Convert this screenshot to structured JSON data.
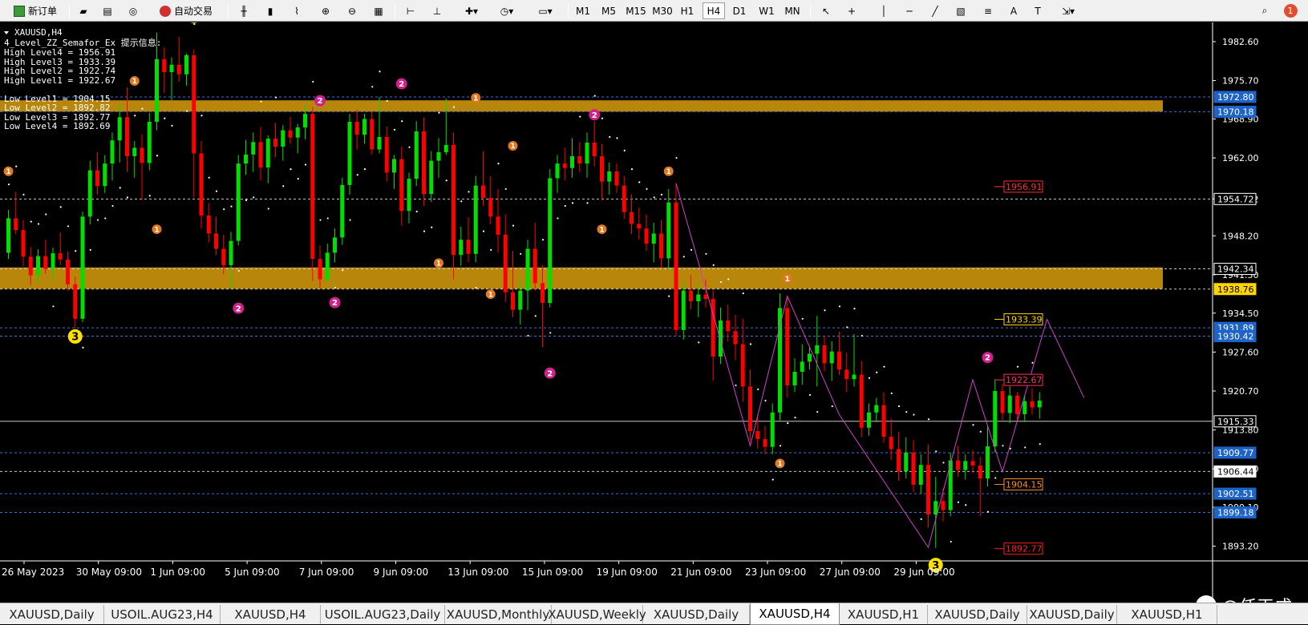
{
  "toolbar": {
    "new_order": "新订单",
    "auto_trade": "自动交易",
    "timeframes": [
      "M1",
      "M5",
      "M15",
      "M30",
      "H1",
      "H4",
      "D1",
      "W1",
      "MN"
    ],
    "active_timeframe": "H4",
    "notification_count": "1"
  },
  "chart_info": {
    "symbol": "XAUUSD,H4",
    "indicator_title": "4_Level_ZZ_Semafor_Ex 提示信息:",
    "lines": [
      "High Level4 = 1956.91",
      "High Level3 = 1933.39",
      "High Level2 = 1922.74",
      "High Level1 = 1922.67",
      "",
      "Low Level1 = 1904.15",
      "Low Level2 = 1892.82",
      "Low Level3 = 1892.77",
      "Low Level4 = 1892.69"
    ]
  },
  "price_axis": {
    "ticks": [
      "1982.60",
      "1975.70",
      "1968.90",
      "1962.00",
      "1954.72",
      "1948.20",
      "1941.30",
      "1934.50",
      "1927.60",
      "1920.70",
      "1913.80",
      "1906.90",
      "1900.10",
      "1893.20"
    ],
    "highlights": [
      {
        "label": "1972.80",
        "price": 1972.8,
        "bg": "#1e64c8",
        "fg": "#ffffff"
      },
      {
        "label": "1970.18",
        "price": 1970.18,
        "bg": "#1e64c8",
        "fg": "#ffffff"
      },
      {
        "label": "1954.72",
        "price": 1954.72,
        "bg": "#000000",
        "fg": "#ffffff"
      },
      {
        "label": "1942.34",
        "price": 1942.34,
        "bg": "#000000",
        "fg": "#ffffff"
      },
      {
        "label": "1938.76",
        "price": 1938.76,
        "bg": "#ffd400",
        "fg": "#000000"
      },
      {
        "label": "1931.89",
        "price": 1931.89,
        "bg": "#1e64c8",
        "fg": "#ffffff"
      },
      {
        "label": "1930.42",
        "price": 1930.42,
        "bg": "#1e64c8",
        "fg": "#ffffff"
      },
      {
        "label": "1915.33",
        "price": 1915.33,
        "bg": "#000000",
        "fg": "#ffffff"
      },
      {
        "label": "1909.77",
        "price": 1909.77,
        "bg": "#1e64c8",
        "fg": "#ffffff"
      },
      {
        "label": "1906.44",
        "price": 1906.44,
        "bg": "#ffffff",
        "fg": "#000000"
      },
      {
        "label": "1902.51",
        "price": 1902.51,
        "bg": "#1e64c8",
        "fg": "#ffffff"
      },
      {
        "label": "1899.18",
        "price": 1899.18,
        "bg": "#1e64c8",
        "fg": "#ffffff"
      }
    ]
  },
  "level_labels": [
    {
      "label": "1956.91",
      "price": 1956.91,
      "color": "#ff3030"
    },
    {
      "label": "1933.39",
      "price": 1933.39,
      "color": "#ffd400"
    },
    {
      "label": "1922.67",
      "price": 1922.67,
      "color": "#ff3060"
    },
    {
      "label": "1904.15",
      "price": 1904.15,
      "color": "#ff8c20"
    },
    {
      "label": "1892.77",
      "price": 1892.77,
      "color": "#ff2020"
    }
  ],
  "time_axis": [
    "26 May 2023",
    "30 May 09:00",
    "1 Jun 09:00",
    "5 Jun 09:00",
    "7 Jun 09:00",
    "9 Jun 09:00",
    "13 Jun 09:00",
    "15 Jun 09:00",
    "19 Jun 09:00",
    "21 Jun 09:00",
    "23 Jun 09:00",
    "27 Jun 09:00",
    "29 Jun 09:00"
  ],
  "zones": [
    {
      "top": 1972.2,
      "bottom": 1970.2,
      "color": "#b8860b"
    },
    {
      "top": 1942.6,
      "bottom": 1938.8,
      "color": "#b8860b"
    }
  ],
  "tabs": [
    "XAUUSD,Daily",
    "USOIL.AUG23,H4",
    "XAUUSD,H4",
    "USOIL.AUG23,Daily",
    "XAUUSD,Monthly",
    "XAUUSD,Weekly",
    "XAUUSD,Daily",
    "XAUUSD,H4",
    "XAUUSD,H1",
    "XAUUSD,Daily",
    "XAUUSD,Daily",
    "XAUUSD,H1"
  ],
  "active_tab_index": 7,
  "watermark": "@任天成",
  "colors": {
    "bull": "#00e000",
    "bear": "#ff0000",
    "zigzag": "#d040d0",
    "zone": "#b8860b",
    "sar": "#ffffff"
  },
  "chart_data": {
    "type": "candlestick",
    "symbol": "XAUUSD",
    "timeframe": "H4",
    "ylim": [
      1890.6,
      1986.0
    ],
    "current_price": 1915.33,
    "zigzag_projection": [
      {
        "bar": 90,
        "price": 1957.5
      },
      {
        "bar": 100,
        "price": 1911.0
      },
      {
        "bar": 105,
        "price": 1937.5
      },
      {
        "bar": 112,
        "price": 1916.5
      },
      {
        "bar": 124,
        "price": 1893.0
      },
      {
        "bar": 130,
        "price": 1922.7
      },
      {
        "bar": 134,
        "price": 1906.4
      },
      {
        "bar": 140,
        "price": 1933.4
      },
      {
        "bar": 145,
        "price": 1919.5
      }
    ],
    "semafor_points": [
      {
        "bar": 9,
        "price": 1931.5,
        "level": 3,
        "pos": "below"
      },
      {
        "bar": 25,
        "price": 1986.0,
        "level": 3,
        "pos": "above"
      },
      {
        "bar": 31,
        "price": 1936.5,
        "level": 2,
        "pos": "below"
      },
      {
        "bar": 42,
        "price": 1971.0,
        "level": 2,
        "pos": "above"
      },
      {
        "bar": 44,
        "price": 1937.5,
        "level": 2,
        "pos": "below"
      },
      {
        "bar": 53,
        "price": 1974.0,
        "level": 2,
        "pos": "above"
      },
      {
        "bar": 73,
        "price": 1925.0,
        "level": 2,
        "pos": "below"
      },
      {
        "bar": 79,
        "price": 1968.5,
        "level": 2,
        "pos": "above"
      },
      {
        "bar": 132,
        "price": 1925.5,
        "level": 2,
        "pos": "above"
      },
      {
        "bar": 125,
        "price": 1891.0,
        "level": 3,
        "pos": "below"
      },
      {
        "bar": 17,
        "price": 1974.5,
        "level": 1,
        "pos": "above"
      },
      {
        "bar": 20,
        "price": 1950.5,
        "level": 1,
        "pos": "below"
      },
      {
        "bar": 58,
        "price": 1944.5,
        "level": 1,
        "pos": "below"
      },
      {
        "bar": 63,
        "price": 1971.5,
        "level": 1,
        "pos": "above"
      },
      {
        "bar": 65,
        "price": 1939.0,
        "level": 1,
        "pos": "below"
      },
      {
        "bar": 68,
        "price": 1963.0,
        "level": 1,
        "pos": "above"
      },
      {
        "bar": 80,
        "price": 1950.5,
        "level": 1,
        "pos": "below"
      },
      {
        "bar": 89,
        "price": 1958.5,
        "level": 1,
        "pos": "above"
      },
      {
        "bar": 105,
        "price": 1939.5,
        "level": 1,
        "pos": "above"
      },
      {
        "bar": 104,
        "price": 1909.0,
        "level": 1,
        "pos": "below"
      },
      {
        "bar": 0,
        "price": 1958.5,
        "level": 1,
        "pos": "above"
      }
    ],
    "candles": [
      [
        1945.2,
        1952.8,
        1944.1,
        1951.3
      ],
      [
        1951.3,
        1956.0,
        1948.5,
        1949.2
      ],
      [
        1949.2,
        1951.0,
        1942.8,
        1944.5
      ],
      [
        1944.5,
        1946.2,
        1939.5,
        1941.2
      ],
      [
        1941.2,
        1945.8,
        1939.8,
        1944.6
      ],
      [
        1944.6,
        1947.5,
        1941.5,
        1942.3
      ],
      [
        1942.3,
        1946.1,
        1940.2,
        1945.1
      ],
      [
        1945.1,
        1948.8,
        1943.0,
        1944.0
      ],
      [
        1944.0,
        1945.4,
        1938.5,
        1939.6
      ],
      [
        1939.6,
        1941.0,
        1931.8,
        1933.5
      ],
      [
        1933.5,
        1952.5,
        1932.9,
        1951.6
      ],
      [
        1951.6,
        1961.5,
        1950.2,
        1959.8
      ],
      [
        1959.8,
        1963.0,
        1955.5,
        1957.0
      ],
      [
        1957.0,
        1962.5,
        1955.8,
        1961.0
      ],
      [
        1961.0,
        1966.5,
        1958.0,
        1965.1
      ],
      [
        1965.1,
        1971.4,
        1961.2,
        1969.2
      ],
      [
        1969.2,
        1974.5,
        1959.5,
        1962.3
      ],
      [
        1962.3,
        1965.0,
        1958.5,
        1963.8
      ],
      [
        1963.8,
        1966.2,
        1954.5,
        1961.1
      ],
      [
        1961.1,
        1970.0,
        1959.8,
        1968.4
      ],
      [
        1968.4,
        1984.2,
        1966.9,
        1979.5
      ],
      [
        1979.5,
        1981.6,
        1973.5,
        1977.2
      ],
      [
        1977.2,
        1979.8,
        1972.2,
        1978.5
      ],
      [
        1978.5,
        1983.5,
        1975.5,
        1976.8
      ],
      [
        1976.8,
        1980.5,
        1974.8,
        1980.2
      ],
      [
        1980.2,
        1981.2,
        1955.0,
        1962.8
      ],
      [
        1962.8,
        1965.0,
        1949.5,
        1951.8
      ],
      [
        1951.8,
        1954.0,
        1947.0,
        1948.6
      ],
      [
        1948.6,
        1951.6,
        1944.8,
        1945.9
      ],
      [
        1945.9,
        1948.4,
        1941.4,
        1943.0
      ],
      [
        1943.0,
        1948.9,
        1938.8,
        1947.3
      ],
      [
        1947.3,
        1962.5,
        1946.5,
        1961.0
      ],
      [
        1961.0,
        1965.2,
        1959.0,
        1962.6
      ],
      [
        1962.6,
        1966.5,
        1959.5,
        1964.8
      ],
      [
        1964.8,
        1967.5,
        1958.0,
        1960.3
      ],
      [
        1960.3,
        1966.0,
        1957.5,
        1965.4
      ],
      [
        1965.4,
        1968.2,
        1962.1,
        1964.0
      ],
      [
        1964.0,
        1967.8,
        1961.5,
        1966.9
      ],
      [
        1966.9,
        1969.3,
        1964.5,
        1965.6
      ],
      [
        1965.6,
        1968.0,
        1962.8,
        1967.4
      ],
      [
        1967.4,
        1971.5,
        1965.3,
        1969.8
      ],
      [
        1969.8,
        1971.0,
        1940.2,
        1944.1
      ],
      [
        1944.1,
        1946.5,
        1939.0,
        1940.5
      ],
      [
        1940.5,
        1946.8,
        1939.8,
        1945.2
      ],
      [
        1945.2,
        1949.5,
        1943.5,
        1947.9
      ],
      [
        1947.9,
        1958.5,
        1946.6,
        1957.2
      ],
      [
        1957.2,
        1969.8,
        1955.5,
        1968.4
      ],
      [
        1968.4,
        1970.5,
        1963.5,
        1966.1
      ],
      [
        1966.1,
        1969.8,
        1964.5,
        1968.9
      ],
      [
        1968.9,
        1970.1,
        1962.6,
        1963.5
      ],
      [
        1963.5,
        1972.8,
        1962.8,
        1965.7
      ],
      [
        1965.7,
        1967.6,
        1957.8,
        1959.4
      ],
      [
        1959.4,
        1962.5,
        1956.5,
        1961.8
      ],
      [
        1961.8,
        1964.0,
        1950.0,
        1952.6
      ],
      [
        1952.6,
        1959.4,
        1950.4,
        1958.3
      ],
      [
        1958.3,
        1968.5,
        1957.0,
        1966.7
      ],
      [
        1966.7,
        1969.2,
        1953.5,
        1955.6
      ],
      [
        1955.6,
        1963.2,
        1954.2,
        1961.5
      ],
      [
        1961.5,
        1965.5,
        1958.5,
        1963.0
      ],
      [
        1963.0,
        1972.5,
        1962.5,
        1964.3
      ],
      [
        1964.3,
        1966.5,
        1940.5,
        1944.8
      ],
      [
        1944.8,
        1949.8,
        1942.9,
        1947.5
      ],
      [
        1947.5,
        1951.5,
        1943.5,
        1945.0
      ],
      [
        1945.0,
        1958.8,
        1943.5,
        1957.1
      ],
      [
        1957.1,
        1963.2,
        1953.5,
        1954.9
      ],
      [
        1954.9,
        1958.8,
        1950.2,
        1951.6
      ],
      [
        1951.6,
        1956.5,
        1945.2,
        1948.4
      ],
      [
        1948.4,
        1952.0,
        1936.5,
        1938.2
      ],
      [
        1938.2,
        1945.5,
        1933.8,
        1935.1
      ],
      [
        1935.1,
        1940.5,
        1932.5,
        1938.5
      ],
      [
        1938.5,
        1947.5,
        1935.0,
        1945.9
      ],
      [
        1945.9,
        1950.5,
        1938.5,
        1939.8
      ],
      [
        1939.8,
        1943.0,
        1928.5,
        1936.3
      ],
      [
        1936.3,
        1960.0,
        1935.5,
        1958.4
      ],
      [
        1958.4,
        1962.5,
        1955.8,
        1961.0
      ],
      [
        1961.0,
        1963.8,
        1958.0,
        1960.2
      ],
      [
        1960.2,
        1965.5,
        1958.5,
        1962.3
      ],
      [
        1962.3,
        1964.8,
        1959.5,
        1961.0
      ],
      [
        1961.0,
        1966.5,
        1958.5,
        1964.7
      ],
      [
        1964.7,
        1968.5,
        1960.5,
        1962.3
      ],
      [
        1962.3,
        1964.5,
        1954.5,
        1957.8
      ],
      [
        1957.8,
        1961.2,
        1955.5,
        1959.6
      ],
      [
        1959.6,
        1961.0,
        1955.8,
        1957.1
      ],
      [
        1957.1,
        1958.8,
        1951.2,
        1952.4
      ],
      [
        1952.4,
        1955.5,
        1948.5,
        1950.3
      ],
      [
        1950.3,
        1953.2,
        1947.5,
        1949.5
      ],
      [
        1949.5,
        1952.0,
        1945.5,
        1946.8
      ],
      [
        1946.8,
        1950.5,
        1943.5,
        1948.6
      ],
      [
        1948.6,
        1951.0,
        1942.5,
        1944.2
      ],
      [
        1944.2,
        1956.5,
        1942.0,
        1954.1
      ],
      [
        1954.1,
        1957.5,
        1930.5,
        1931.5
      ],
      [
        1931.5,
        1940.0,
        1929.8,
        1938.5
      ],
      [
        1938.5,
        1941.2,
        1935.2,
        1936.6
      ],
      [
        1936.6,
        1939.5,
        1933.8,
        1937.8
      ],
      [
        1937.8,
        1940.5,
        1935.5,
        1937.0
      ],
      [
        1937.0,
        1938.5,
        1922.5,
        1926.8
      ],
      [
        1926.8,
        1935.5,
        1925.5,
        1933.2
      ],
      [
        1933.2,
        1936.0,
        1929.5,
        1931.3
      ],
      [
        1931.3,
        1934.2,
        1926.2,
        1929.0
      ],
      [
        1929.0,
        1933.5,
        1918.8,
        1921.5
      ],
      [
        1921.5,
        1924.5,
        1911.8,
        1913.6
      ],
      [
        1913.6,
        1916.5,
        1910.5,
        1912.2
      ],
      [
        1912.2,
        1914.5,
        1909.5,
        1910.8
      ],
      [
        1910.8,
        1918.5,
        1909.5,
        1916.9
      ],
      [
        1916.9,
        1938.0,
        1915.5,
        1935.4
      ],
      [
        1935.4,
        1937.5,
        1919.5,
        1921.7
      ],
      [
        1921.7,
        1926.5,
        1920.5,
        1924.1
      ],
      [
        1924.1,
        1929.0,
        1921.8,
        1925.9
      ],
      [
        1925.9,
        1928.5,
        1924.5,
        1927.3
      ],
      [
        1927.3,
        1934.0,
        1921.5,
        1928.8
      ],
      [
        1928.8,
        1930.5,
        1924.2,
        1925.6
      ],
      [
        1925.6,
        1929.5,
        1922.5,
        1927.7
      ],
      [
        1927.7,
        1931.2,
        1923.5,
        1924.5
      ],
      [
        1924.5,
        1927.5,
        1920.5,
        1922.8
      ],
      [
        1922.8,
        1930.8,
        1921.5,
        1923.6
      ],
      [
        1923.6,
        1926.0,
        1912.5,
        1914.2
      ],
      [
        1914.2,
        1918.5,
        1912.8,
        1916.9
      ],
      [
        1916.9,
        1919.5,
        1915.2,
        1918.2
      ],
      [
        1918.2,
        1920.5,
        1911.5,
        1912.6
      ],
      [
        1912.6,
        1915.8,
        1908.5,
        1910.4
      ],
      [
        1910.4,
        1913.5,
        1904.8,
        1906.5
      ],
      [
        1906.5,
        1912.5,
        1905.2,
        1909.8
      ],
      [
        1909.8,
        1912.0,
        1902.8,
        1904.1
      ],
      [
        1904.1,
        1909.5,
        1902.5,
        1907.6
      ],
      [
        1907.6,
        1911.2,
        1896.5,
        1898.8
      ],
      [
        1898.8,
        1905.5,
        1892.9,
        1901.2
      ],
      [
        1901.2,
        1903.5,
        1897.6,
        1899.6
      ],
      [
        1899.6,
        1909.8,
        1898.5,
        1908.4
      ],
      [
        1908.4,
        1911.0,
        1905.5,
        1906.7
      ],
      [
        1906.7,
        1909.5,
        1905.0,
        1908.3
      ],
      [
        1908.3,
        1910.2,
        1906.2,
        1907.5
      ],
      [
        1907.5,
        1909.0,
        1898.5,
        1905.2
      ],
      [
        1905.2,
        1914.5,
        1903.8,
        1910.9
      ],
      [
        1910.9,
        1922.8,
        1909.8,
        1920.7
      ],
      [
        1920.7,
        1922.0,
        1915.5,
        1916.8
      ],
      [
        1916.8,
        1921.5,
        1915.0,
        1919.9
      ],
      [
        1919.9,
        1920.5,
        1915.5,
        1916.6
      ],
      [
        1916.6,
        1919.8,
        1915.2,
        1918.9
      ],
      [
        1918.9,
        1921.2,
        1916.5,
        1917.8
      ],
      [
        1917.8,
        1920.5,
        1915.8,
        1919.0
      ]
    ]
  }
}
